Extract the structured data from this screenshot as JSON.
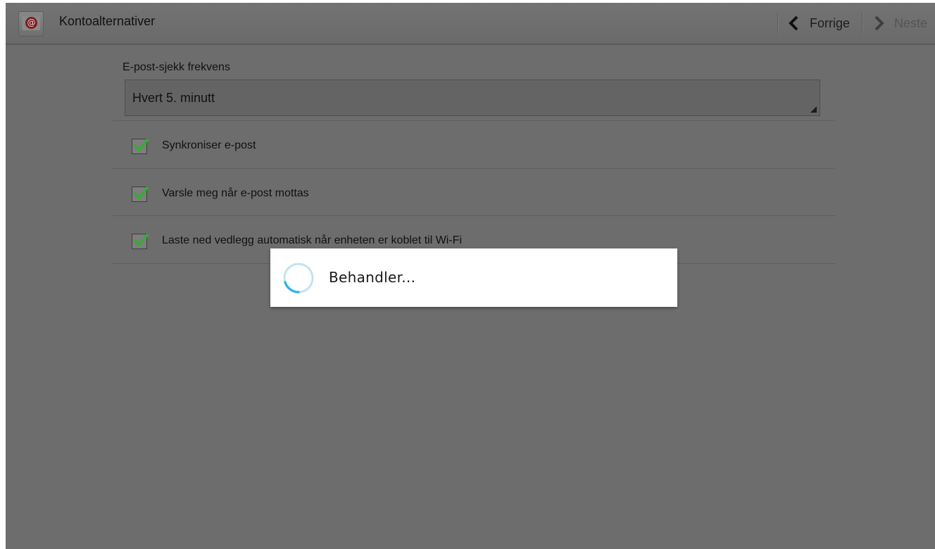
{
  "actionbar": {
    "title": "Kontoalternativer",
    "icon": "email-at-icon",
    "prev_label": "Forrige",
    "next_label": "Neste"
  },
  "settings": {
    "frequency_label": "E-post-sjekk frekvens",
    "frequency_value": "Hvert 5. minutt",
    "options": [
      {
        "label": "Synkroniser e-post",
        "checked": true
      },
      {
        "label": "Varsle meg når e-post mottas",
        "checked": true
      },
      {
        "label": "Laste ned vedlegg automatisk når enheten er koblet til Wi-Fi",
        "checked": true
      }
    ]
  },
  "dialog": {
    "message": "Behandler..."
  },
  "colors": {
    "dim_background": "#6d6d6d",
    "checkmark": "#3aa83a",
    "spinner": "#33b5e5",
    "dialog_background": "#ffffff"
  }
}
